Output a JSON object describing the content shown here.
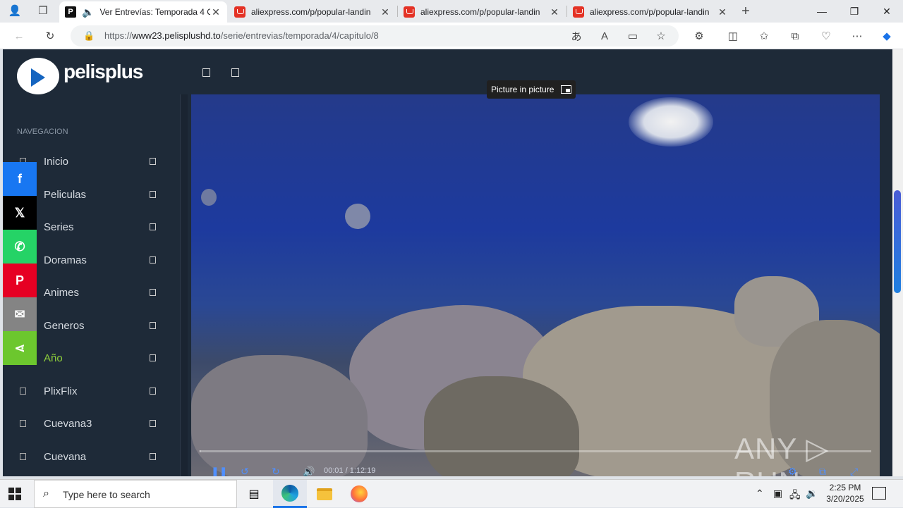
{
  "browser": {
    "tabs": [
      {
        "title": "Ver Entrevías: Temporada 4 C",
        "active": true,
        "favicon": "pelisplus-favicon"
      },
      {
        "title": "aliexpress.com/p/popular-landin",
        "active": false,
        "favicon": "aliexpress-favicon"
      },
      {
        "title": "aliexpress.com/p/popular-landin",
        "active": false,
        "favicon": "aliexpress-favicon"
      },
      {
        "title": "aliexpress.com/p/popular-landin",
        "active": false,
        "favicon": "aliexpress-favicon"
      }
    ],
    "url_prefix": "https://",
    "url_host": "www23.pelisplushd.to",
    "url_path": "/serie/entrevias/temporada/4/capitulo/8"
  },
  "site": {
    "logo_text": "pelisplus",
    "nav_label": "NAVEGACION",
    "nav_items": [
      {
        "label": "Inicio"
      },
      {
        "label": "Peliculas"
      },
      {
        "label": "Series"
      },
      {
        "label": "Doramas"
      },
      {
        "label": "Animes"
      },
      {
        "label": "Generos"
      },
      {
        "label": "Año",
        "current": true
      },
      {
        "label": "PlixFlix"
      },
      {
        "label": "Cuevana3"
      },
      {
        "label": "Cuevana"
      }
    ],
    "share_buttons": [
      {
        "name": "facebook",
        "glyph": "f",
        "color": "#1877f2"
      },
      {
        "name": "x",
        "glyph": "𝕏",
        "color": "#000000"
      },
      {
        "name": "whatsapp",
        "glyph": "✆",
        "color": "#25d366"
      },
      {
        "name": "pinterest",
        "glyph": "P",
        "color": "#e60023"
      },
      {
        "name": "email",
        "glyph": "✉",
        "color": "#848484"
      },
      {
        "name": "share",
        "glyph": "⋖",
        "color": "#6cc72e"
      }
    ]
  },
  "player": {
    "pip_tooltip": "Picture in picture",
    "current_time": "00:01",
    "time_separator": "/",
    "duration": "1:12:19",
    "progress_fraction": 0.001,
    "watermark": "ANY ▷ RUN"
  },
  "taskbar": {
    "search_placeholder": "Type here to search",
    "time": "2:25 PM",
    "date": "3/20/2025"
  }
}
